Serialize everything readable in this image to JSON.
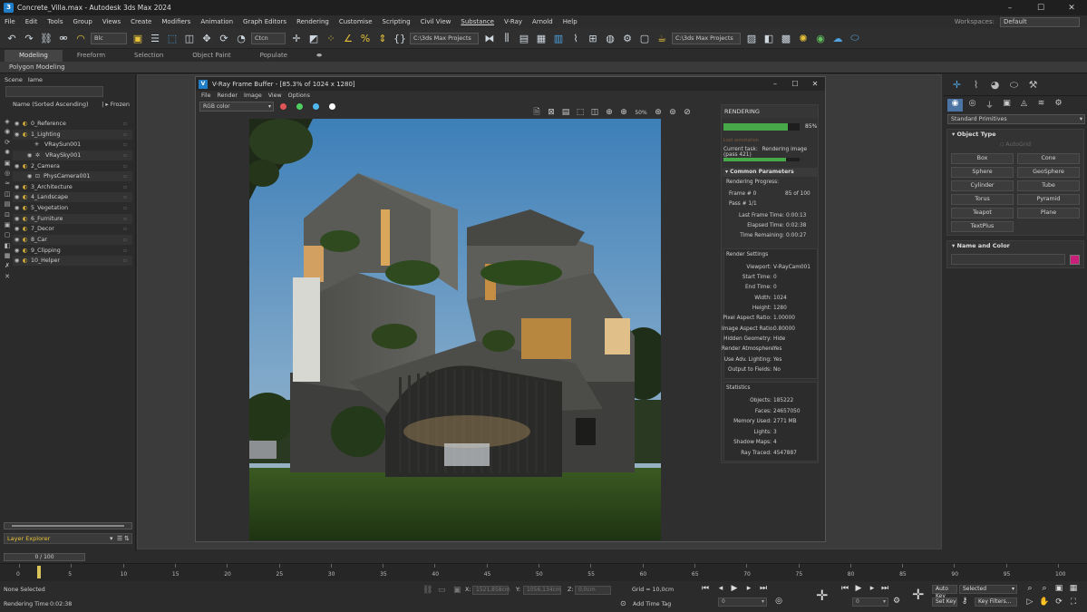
{
  "window": {
    "title": "Concrete_Villa.max - Autodesk 3ds Max 2024",
    "min": "–",
    "max": "☐",
    "close": "✕"
  },
  "menu": [
    "File",
    "Edit",
    "Tools",
    "Group",
    "Views",
    "Create",
    "Modifiers",
    "Animation",
    "Graph Editors",
    "Rendering",
    "Customise",
    "Scripting",
    "Civil View",
    "Substance",
    "V-Ray",
    "Arnold",
    "Help"
  ],
  "workspaces": {
    "label": "Workspaces:",
    "value": "Default"
  },
  "toolbar": {
    "selection_filter": "Blc",
    "ref_coord": "Ctcn",
    "project_path_1": "C:\\3ds Max Projects",
    "project_path_2": "C:\\3ds Max Projects"
  },
  "ribbon": {
    "tabs": [
      "Modeling",
      "Freeform",
      "Selection",
      "Object Paint",
      "Populate"
    ],
    "active": "Modeling",
    "subtitle": "Polygon Modeling"
  },
  "scene_explorer": {
    "header": [
      "Scene",
      "Iame"
    ],
    "column_header": "Name (Sorted Ascending)",
    "frozen": "Frozen",
    "layers": [
      {
        "name": "0_Reference",
        "indent": 0
      },
      {
        "name": "1_Lighting",
        "indent": 0
      },
      {
        "name": "VRaySun001",
        "indent": 2
      },
      {
        "name": "VRaySky001",
        "indent": 2
      },
      {
        "name": "2_Camera",
        "indent": 0
      },
      {
        "name": "PhysCamera001",
        "indent": 2
      },
      {
        "name": "3_Architecture",
        "indent": 0
      },
      {
        "name": "4_Landscape",
        "indent": 0
      },
      {
        "name": "5_Vegetation",
        "indent": 0
      },
      {
        "name": "6_Furniture",
        "indent": 0
      },
      {
        "name": "7_Decor",
        "indent": 0
      },
      {
        "name": "8_Car",
        "indent": 0
      },
      {
        "name": "9_Clipping",
        "indent": 0
      },
      {
        "name": "10_Helper",
        "indent": 0
      }
    ],
    "explorer_label": "Layer Explorer",
    "frame_counter": "0 / 100"
  },
  "vfb": {
    "title": "V-Ray Frame Buffer - [85.3% of 1024 x 1280]",
    "menu": [
      "File",
      "Render",
      "Image",
      "View",
      "Options"
    ],
    "channel": "RGB color",
    "zoom": "50%",
    "dot_colors": [
      "#e05555",
      "#4fcf5f",
      "#4fb8ef",
      "#ffffff"
    ]
  },
  "rendering_panel": {
    "title": "RENDERING",
    "progress_pct": 85,
    "progress_label": "85%",
    "note": "Lost annotation",
    "current_task_label": "Current task:",
    "current_task": "Rendering image (pass 421)",
    "task_progress_pct": 82,
    "common_params": "Common Parameters",
    "rendering_progress": "Rendering Progress:",
    "frame_label": "Frame # 0",
    "frame_value": "85 of 100",
    "pass_label": "Pass # 1/1",
    "last_frame_time": {
      "k": "Last Frame Time:",
      "v": "0:00:13"
    },
    "elapsed_time": {
      "k": "Elapsed Time:",
      "v": "0:02:38"
    },
    "time_remaining": {
      "k": "Time Remaining:",
      "v": "0:00:27"
    },
    "render_settings_title": "Render Settings",
    "render_settings": [
      {
        "k": "Viewport:",
        "v": "V-RayCam001"
      },
      {
        "k": "Start Time:",
        "v": "0"
      },
      {
        "k": "End Time:",
        "v": "0"
      },
      {
        "k": "Width:",
        "v": "1024"
      },
      {
        "k": "Height:",
        "v": "1280"
      },
      {
        "k": "Pixel Aspect Ratio:",
        "v": "1.00000"
      },
      {
        "k": "Image Aspect Ratio:",
        "v": "0.80000"
      },
      {
        "k": "Hidden Geometry:",
        "v": "Hide"
      },
      {
        "k": "Render Atmosphere:",
        "v": "Yes"
      },
      {
        "k": "Use Adv. Lighting:",
        "v": "Yes"
      },
      {
        "k": "Output to Fields:",
        "v": "No"
      }
    ],
    "statistics_title": "Statistics",
    "statistics": [
      {
        "k": "Objects:",
        "v": "185222"
      },
      {
        "k": "Faces:",
        "v": "24657050"
      },
      {
        "k": "Memory Used:",
        "v": "2771 MB"
      },
      {
        "k": "Lights:",
        "v": "3"
      },
      {
        "k": "Shadow Maps:",
        "v": "4"
      },
      {
        "k": "Ray Traced:",
        "v": "4547887"
      }
    ]
  },
  "command_panel": {
    "dropdown": "Standard Primitives",
    "object_type": "Object Type",
    "autogrid": "AutoGrid",
    "buttons": [
      "Box",
      "Cone",
      "Sphere",
      "GeoSphere",
      "Cylinder",
      "Tube",
      "Torus",
      "Pyramid",
      "Teapot",
      "Plane",
      "TextPlus"
    ],
    "name_and_color": "Name and Color",
    "color": "#c81f79"
  },
  "timeline": {
    "ticks": [
      "0",
      "5",
      "10",
      "15",
      "20",
      "25",
      "30",
      "35",
      "40",
      "45",
      "50",
      "55",
      "60",
      "65",
      "70",
      "75",
      "80",
      "85",
      "90",
      "95",
      "100"
    ],
    "current": "0"
  },
  "status": {
    "selection": "None Selected",
    "render_time_label": "Rendering Time",
    "render_time": "0:02:38",
    "x_label": "X:",
    "x_value": "1521,858cm",
    "y_label": "Y:",
    "y_value": "1056,134cm",
    "z_label": "Z:",
    "z_value": "0,0cm",
    "grid": "Grid = 10,0cm",
    "add_time_tag": "Add Time Tag",
    "frame_field": "0",
    "auto_key": "Auto Key",
    "set_key": "Set Key",
    "selected": "Selected",
    "key_filters": "Key Filters..."
  }
}
